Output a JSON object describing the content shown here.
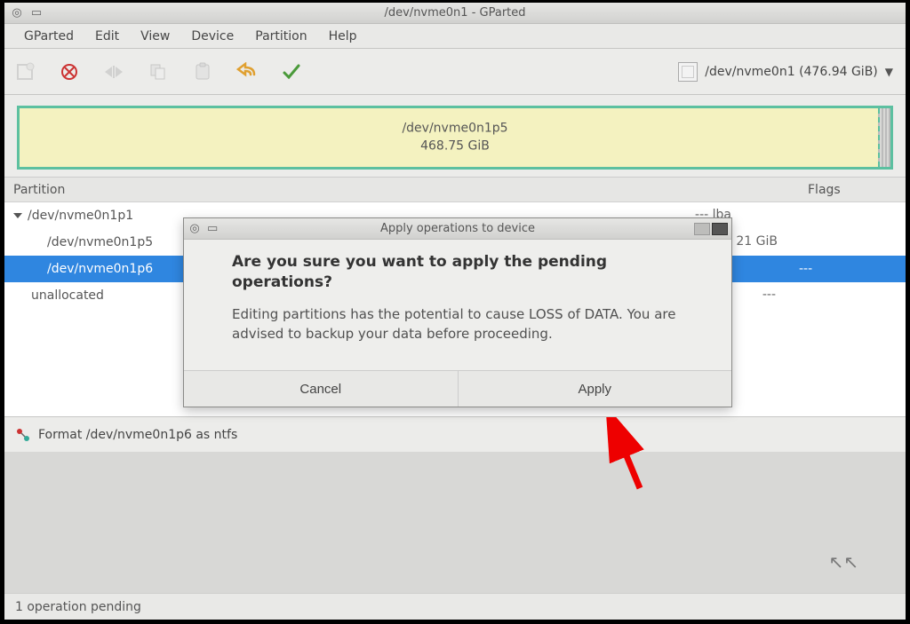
{
  "window": {
    "title": "/dev/nvme0n1 - GParted"
  },
  "menu": {
    "gparted": "GParted",
    "edit": "Edit",
    "view": "View",
    "device": "Device",
    "partition": "Partition",
    "help": "Help"
  },
  "device_selector": "/dev/nvme0n1 (476.94 GiB)",
  "partgraph": {
    "name": "/dev/nvme0n1p5",
    "size": "468.75 GiB"
  },
  "table": {
    "header": {
      "partition": "Partition",
      "flags": "Flags"
    },
    "rows": [
      {
        "name": "/dev/nvme0n1p1",
        "flags": "--- lba",
        "indent": 0,
        "toggle": true,
        "selected": false
      },
      {
        "name": "/dev/nvme0n1p5",
        "flags": "21 GiB",
        "indent": 1,
        "toggle": false,
        "selected": false
      },
      {
        "name": "/dev/nvme0n1p6",
        "flags": "---",
        "indent": 1,
        "toggle": false,
        "selected": true
      },
      {
        "name": "unallocated",
        "flags": "---",
        "indent": 0,
        "toggle": false,
        "selected": false
      }
    ]
  },
  "pending_op": "Format /dev/nvme0n1p6 as ntfs",
  "status": "1 operation pending",
  "dialog": {
    "title": "Apply operations to device",
    "heading": "Are you sure you want to apply the pending operations?",
    "message": "Editing partitions has the potential to cause LOSS of DATA. You are advised to backup your data before proceeding.",
    "cancel": "Cancel",
    "apply": "Apply"
  }
}
